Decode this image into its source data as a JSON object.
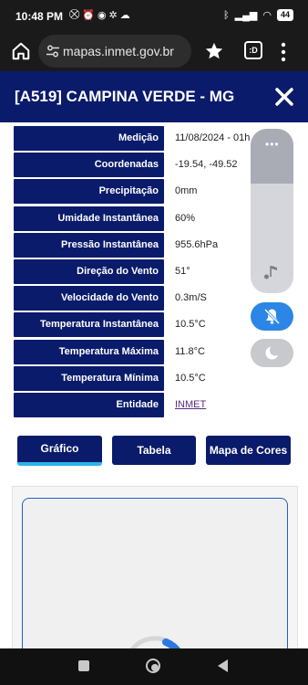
{
  "status_bar": {
    "time": "10:48 PM",
    "battery": "44"
  },
  "browser": {
    "url": "mapas.inmet.gov.br",
    "tabs_label": ":D"
  },
  "header": {
    "title": "[A519] CAMPINA VERDE - MG"
  },
  "rows": [
    {
      "label": "Medição",
      "value": "11/08/2024 - 01h"
    },
    {
      "label": "Coordenadas",
      "value": "-19.54, -49.52"
    },
    {
      "label": "Precipitação",
      "value": "0mm"
    },
    {
      "label": "Umidade Instantânea",
      "value": "60%"
    },
    {
      "label": "Pressão Instantânea",
      "value": "955.6hPa"
    },
    {
      "label": "Direção do Vento",
      "value": "51°"
    },
    {
      "label": "Velocidade do Vento",
      "value": "0.3m/S"
    },
    {
      "label": "Temperatura Instantânea",
      "value": "10.5°C"
    },
    {
      "label": "Temperatura Máxima",
      "value": "11.8°C"
    },
    {
      "label": "Temperatura Mínima",
      "value": "10.5°C"
    },
    {
      "label": "Entidade",
      "value": "INMET"
    }
  ],
  "volume_panel": {
    "dots": "•••"
  },
  "tabs": [
    {
      "label": "Gráfico"
    },
    {
      "label": "Tabela"
    },
    {
      "label": "Mapa de Cores"
    }
  ],
  "colors": {
    "header_bg": "#0a1b6b",
    "active_tab_indicator": "#2cb5e8",
    "link": "#5a2d82"
  }
}
